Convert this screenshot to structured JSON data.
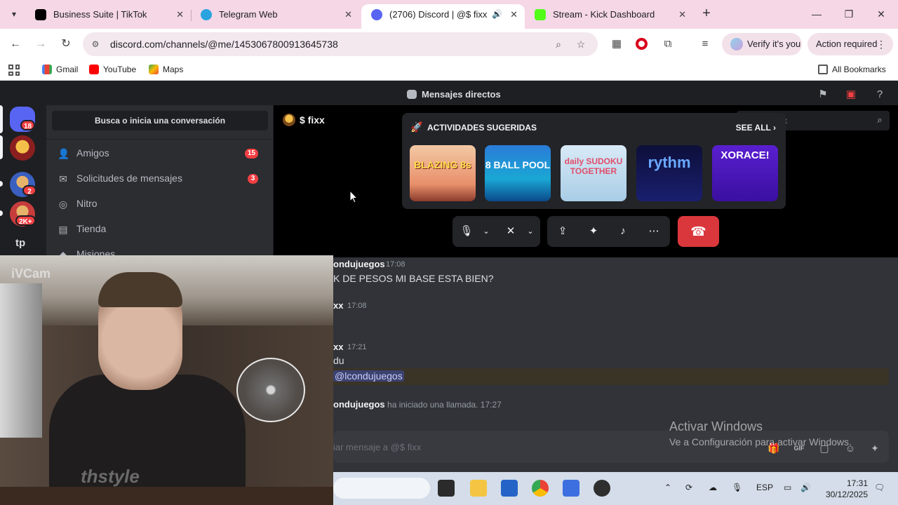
{
  "browser": {
    "tabs": [
      {
        "title": "Business Suite | TikTok",
        "favicon": "tiktok-icon",
        "active": false
      },
      {
        "title": "Telegram Web",
        "favicon": "telegram-icon",
        "active": false
      },
      {
        "title": "(2706) Discord | @$ fixx",
        "favicon": "discord-icon",
        "active": true
      },
      {
        "title": "Stream - Kick Dashboard",
        "favicon": "kick-icon",
        "active": false
      }
    ],
    "url": "discord.com/channels/@me/1453067800913645738",
    "verify_label": "Verify it's you",
    "action_label": "Action required",
    "bookmarks": [
      {
        "label": "Gmail",
        "icon": "gmail-icon"
      },
      {
        "label": "YouTube",
        "icon": "youtube-icon"
      },
      {
        "label": "Maps",
        "icon": "maps-icon"
      }
    ],
    "all_bookmarks": "All Bookmarks"
  },
  "discord": {
    "header_title": "Mensajes directos",
    "guild_badges": [
      "18",
      "2",
      "2K+"
    ],
    "guild_text": "tp",
    "search_placeholder": "Busca o inicia una conversación",
    "dm_nav": [
      {
        "label": "Amigos",
        "icon": "friends-icon",
        "count": "15"
      },
      {
        "label": "Solicitudes de mensajes",
        "icon": "message-requests-icon",
        "count": "3"
      },
      {
        "label": "Nitro",
        "icon": "nitro-icon",
        "count": ""
      },
      {
        "label": "Tienda",
        "icon": "shop-icon",
        "count": ""
      },
      {
        "label": "Misiones",
        "icon": "quests-icon",
        "count": ""
      }
    ],
    "call": {
      "channel_name": "$ fixx",
      "mini_search": "x",
      "activities_title": "ACTIVIDADES SUGERIDAS",
      "see_all": "SEE ALL",
      "activities": [
        "BLAZING 8s",
        "8 BALL POOL",
        "daily SUDOKU TOGETHER",
        "rythm",
        "XORACE!"
      ]
    },
    "messages": [
      {
        "user": "ondujuegos",
        "time": "17:08",
        "text": "K DE PESOS MI BASE ESTA BIEN?"
      },
      {
        "user": "xx",
        "time": "17:08",
        "text": ""
      },
      {
        "user": "xx",
        "time": "17:21",
        "text": "du",
        "mention": "@lcondujuegos"
      }
    ],
    "system": {
      "user": "ondujuegos",
      "text": "ha iniciado una llamada.",
      "time": "17:27"
    },
    "composer_placeholder": "iar mensaje a @$ fixx"
  },
  "webcam": {
    "label": "iVCam",
    "shirt_text": "thstyle"
  },
  "watermark": {
    "line1": "Activar Windows",
    "line2": "Ve a Configuración para activar Windows."
  },
  "taskbar": {
    "language": "ESP",
    "time": "17:31",
    "date": "30/12/2025"
  },
  "colors": {
    "discord_bg": "#313338",
    "hangup": "#da373c",
    "tab_strip": "#f5d7e6",
    "badge": "#f23f43"
  }
}
